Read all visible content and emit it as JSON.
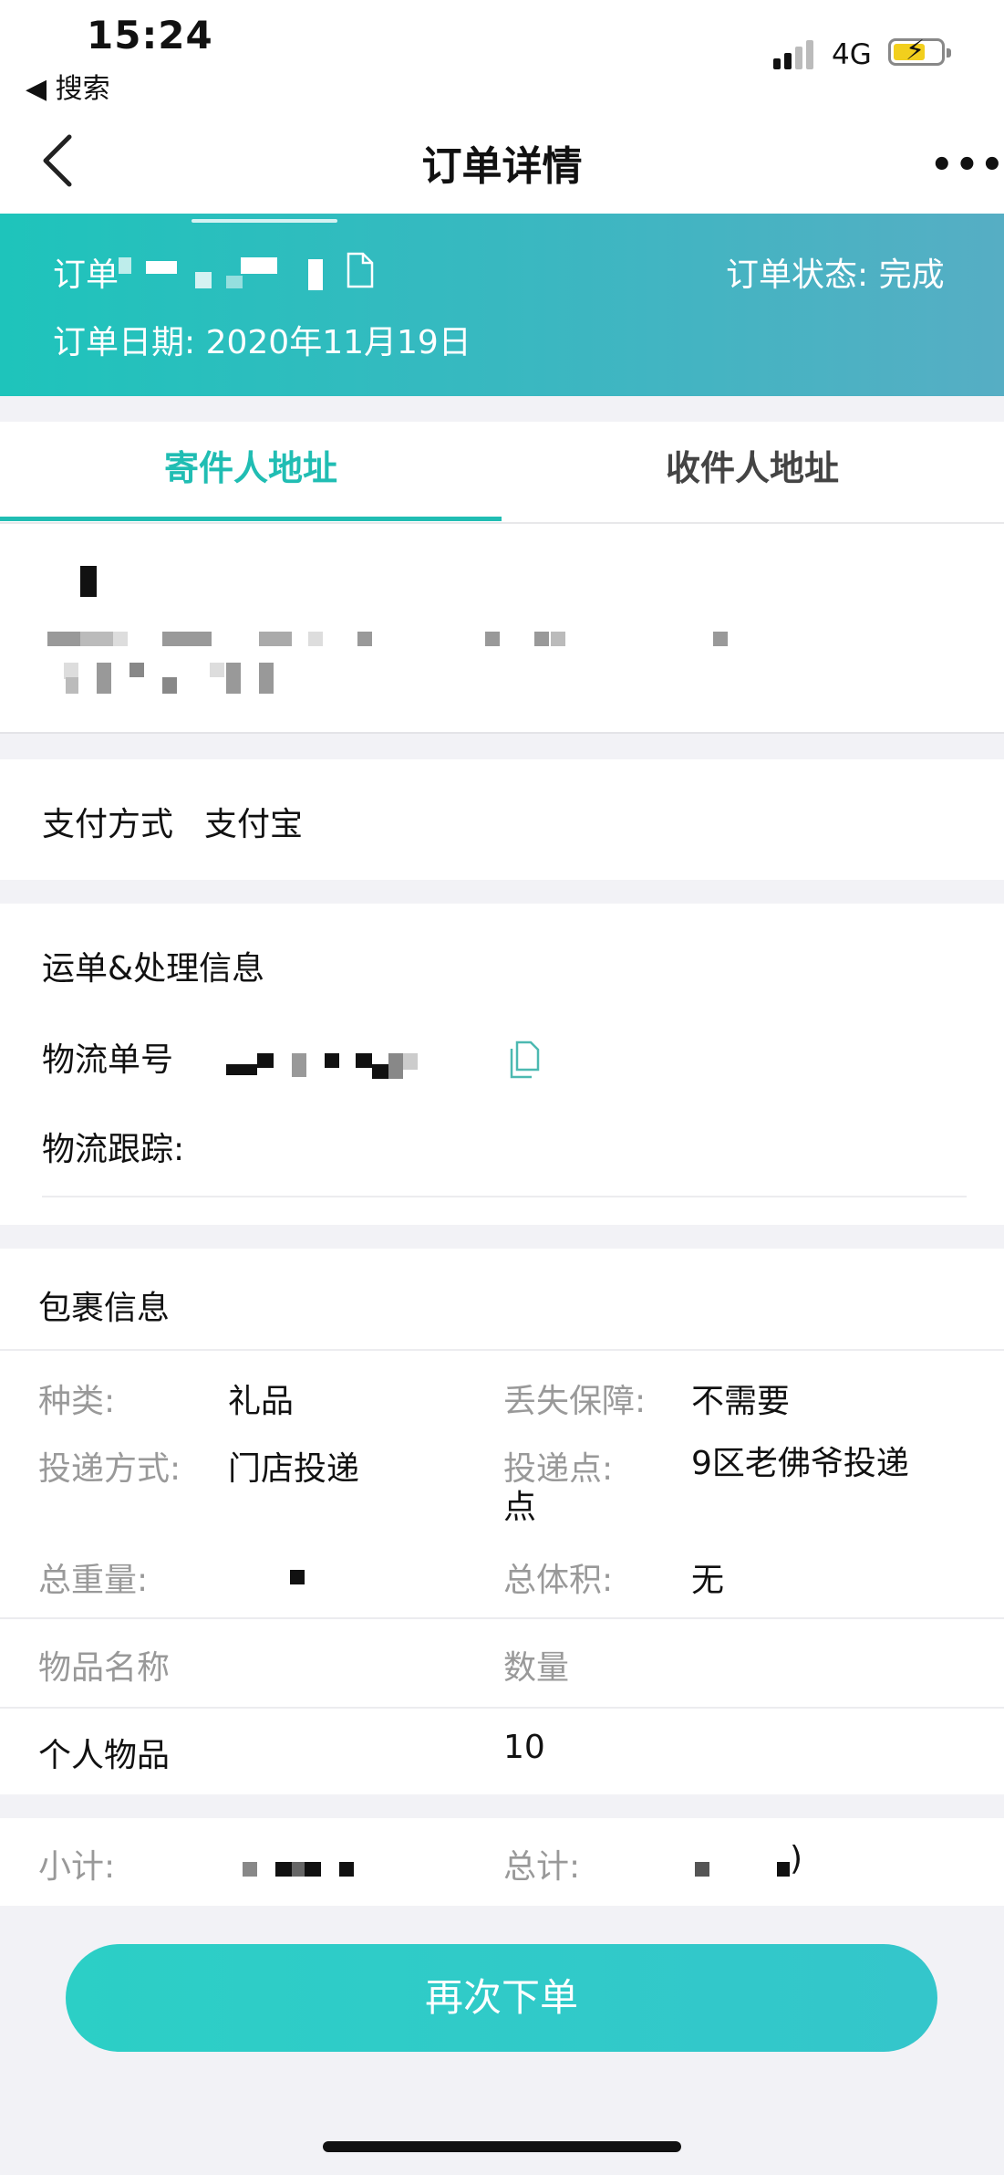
{
  "status_bar": {
    "time": "15:24",
    "back_app": "◀ 搜索",
    "network": "4G"
  },
  "nav": {
    "title": "订单详情",
    "more": "•••"
  },
  "order": {
    "label": "订单",
    "status": "订单状态: 完成",
    "date": "订单日期: 2020年11月19日"
  },
  "tabs": [
    {
      "label": "寄件人地址"
    },
    {
      "label": "收件人地址"
    }
  ],
  "payment": {
    "label": "支付方式",
    "value": "支付宝"
  },
  "waybill": {
    "title": "运单&处理信息",
    "tracking_no_label": "物流单号",
    "tracking_label": "物流跟踪:"
  },
  "package": {
    "title": "包裹信息",
    "category_label": "种类:",
    "category_value": "礼品",
    "insurance_label": "丢失保障:",
    "insurance_value": "不需要",
    "delivery_method_label": "投递方式:",
    "delivery_method_value": "门店投递",
    "delivery_point_label": "投递点:",
    "delivery_point_value": "9区老佛爷投递点",
    "weight_label": "总重量:",
    "volume_label": "总体积:",
    "volume_value": "无",
    "items_header": {
      "name": "物品名称",
      "qty": "数量"
    },
    "items": [
      {
        "name": "个人物品",
        "qty": "10"
      }
    ]
  },
  "totals": {
    "subtotal_label": "小计:",
    "total_label": "总计:",
    "total_suffix": ")"
  },
  "actions": {
    "reorder": "再次下单"
  },
  "colors": {
    "accent": "#20bdb3",
    "header_start": "#1ec4bb",
    "header_end": "#56aec4"
  }
}
